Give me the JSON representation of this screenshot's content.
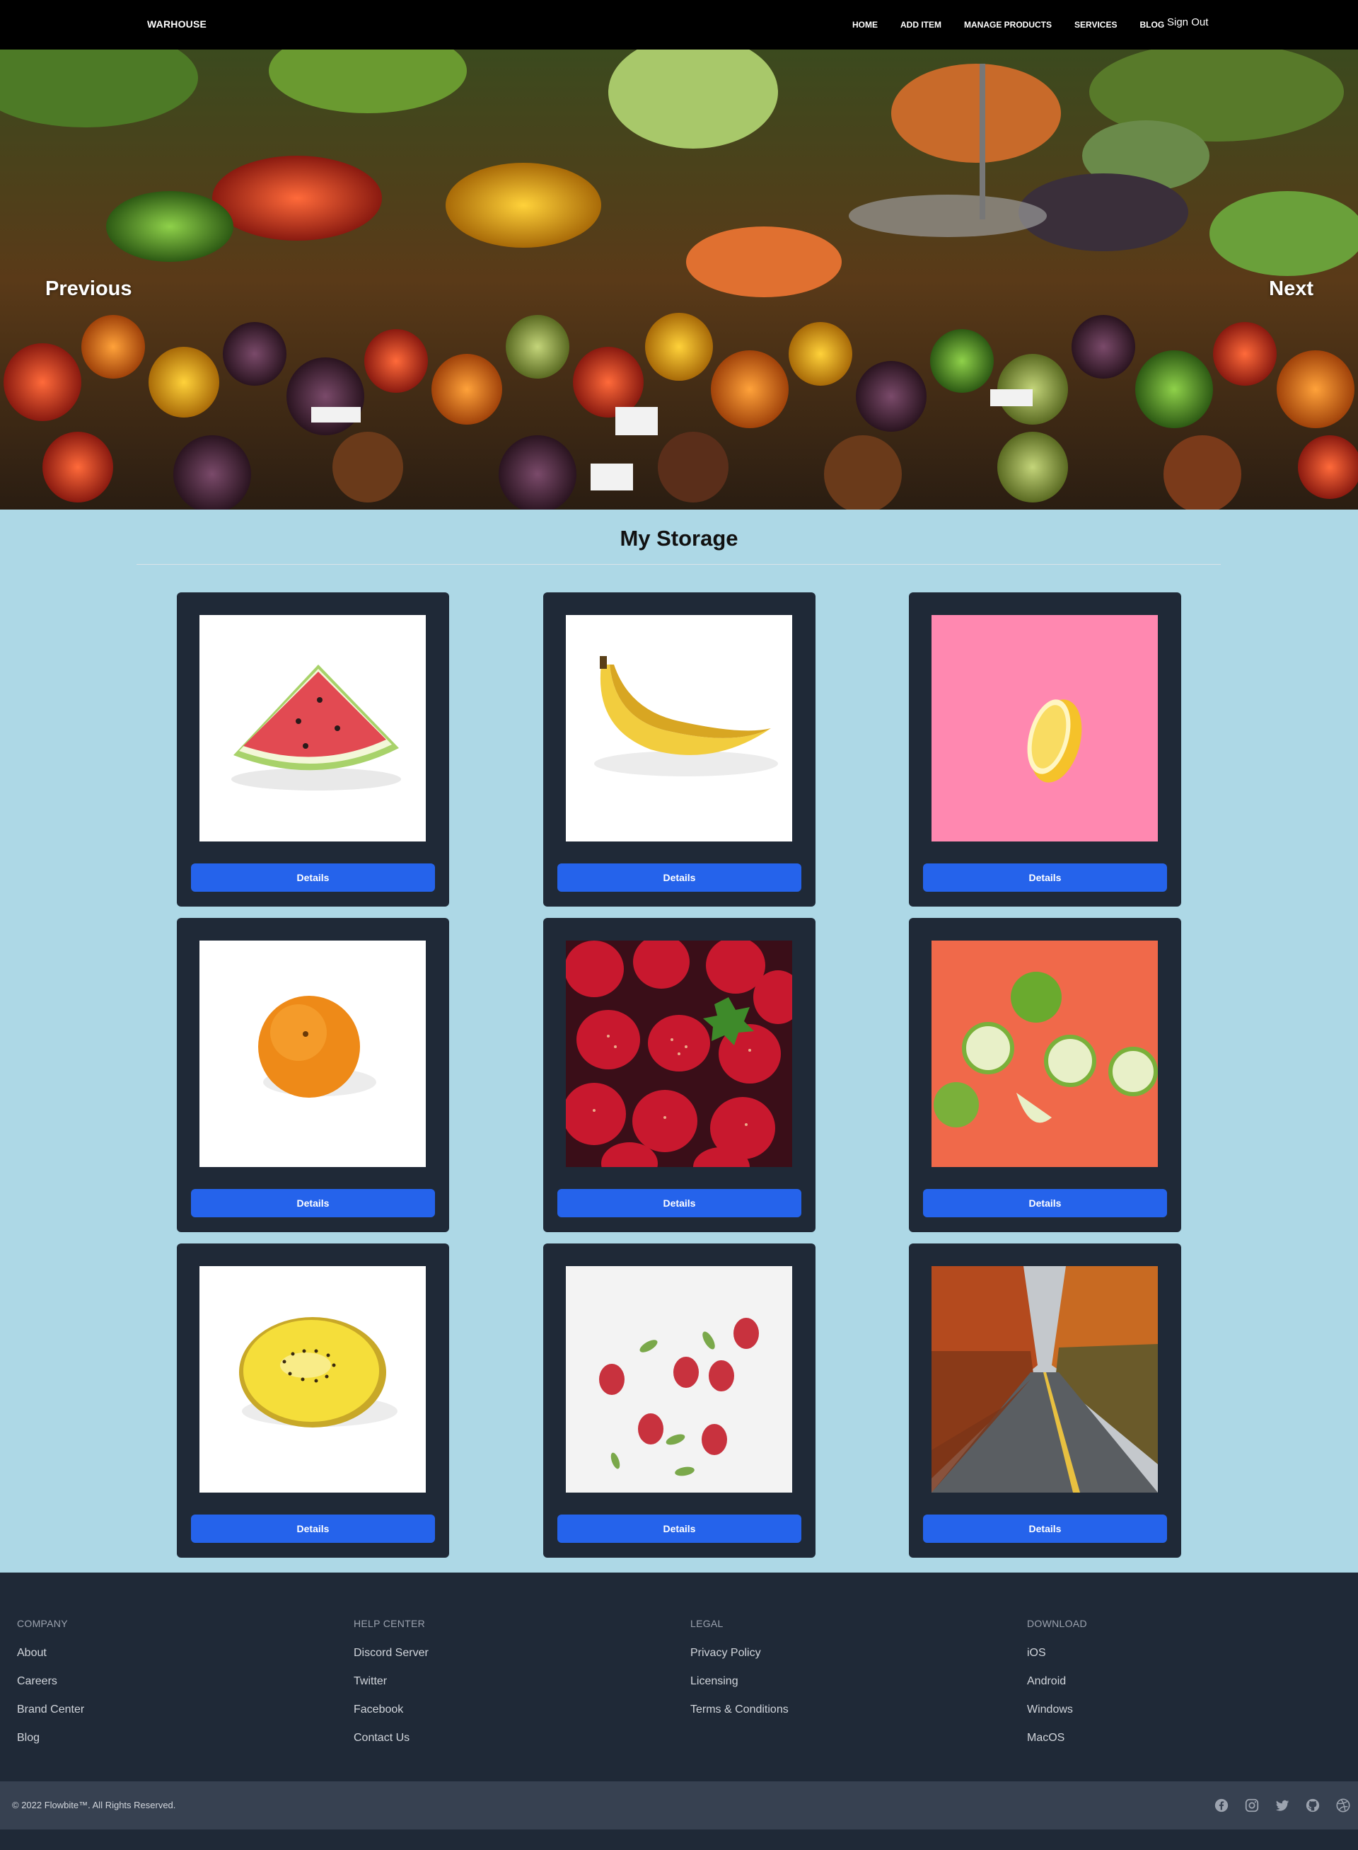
{
  "nav": {
    "brand": "WARHOUSE",
    "links": [
      "HOME",
      "ADD ITEM",
      "MANAGE PRODUCTS",
      "SERVICES",
      "BLOG"
    ],
    "sign_out": "Sign Out"
  },
  "hero": {
    "prev_label": "Previous",
    "next_label": "Next"
  },
  "storage": {
    "title": "My Storage",
    "details_label": "Details",
    "items": [
      {
        "image": "watermark-slice-image"
      },
      {
        "image": "banana-image"
      },
      {
        "image": "lemon-half-image"
      },
      {
        "image": "orange-image"
      },
      {
        "image": "strawberries-image"
      },
      {
        "image": "green-apples-image"
      },
      {
        "image": "yellow-kiwi-image"
      },
      {
        "image": "raspberries-image"
      },
      {
        "image": "autumn-road-image"
      }
    ]
  },
  "footer": {
    "columns": [
      {
        "heading": "COMPANY",
        "links": [
          "About",
          "Careers",
          "Brand Center",
          "Blog"
        ]
      },
      {
        "heading": "HELP CENTER",
        "links": [
          "Discord Server",
          "Twitter",
          "Facebook",
          "Contact Us"
        ]
      },
      {
        "heading": "LEGAL",
        "links": [
          "Privacy Policy",
          "Licensing",
          "Terms & Conditions"
        ]
      },
      {
        "heading": "DOWNLOAD",
        "links": [
          "iOS",
          "Android",
          "Windows",
          "MacOS"
        ]
      }
    ],
    "copyright": "© 2022 Flowbite™. All Rights Reserved.",
    "social_icons": [
      "facebook-icon",
      "instagram-icon",
      "twitter-icon",
      "github-icon",
      "dribbble-icon"
    ]
  },
  "colors": {
    "nav_bg": "#000000",
    "storage_bg": "#add8e6",
    "card_bg": "#1f2937",
    "button": "#2563eb",
    "footer_bg": "#1f2937",
    "footer_bar": "#374151"
  }
}
